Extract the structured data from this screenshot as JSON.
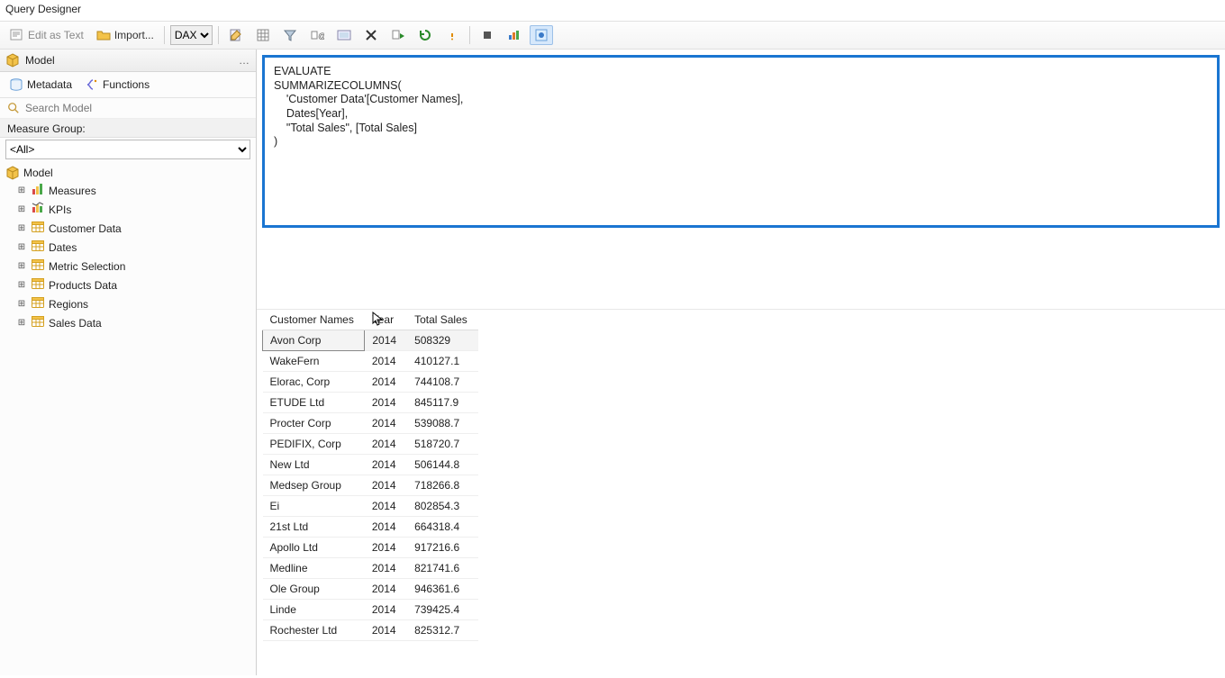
{
  "window": {
    "title": "Query Designer"
  },
  "toolbar": {
    "edit_as_text": "Edit as Text",
    "import": "Import...",
    "lang_value": "DAX"
  },
  "panel": {
    "title": "Model",
    "tab_metadata": "Metadata",
    "tab_functions": "Functions",
    "search_placeholder": "Search Model",
    "measure_group_label": "Measure Group:",
    "measure_group_value": "<All>"
  },
  "tree": {
    "root": "Model",
    "items": [
      {
        "label": "Measures",
        "icon": "measures"
      },
      {
        "label": "KPIs",
        "icon": "kpis"
      },
      {
        "label": "Customer Data",
        "icon": "table"
      },
      {
        "label": "Dates",
        "icon": "table"
      },
      {
        "label": "Metric Selection",
        "icon": "table"
      },
      {
        "label": "Products Data",
        "icon": "table"
      },
      {
        "label": "Regions",
        "icon": "table"
      },
      {
        "label": "Sales Data",
        "icon": "table"
      }
    ]
  },
  "query_text": "EVALUATE\nSUMMARIZECOLUMNS(\n    'Customer Data'[Customer Names],\n    Dates[Year],\n    \"Total Sales\", [Total Sales]\n)",
  "results": {
    "columns": [
      "Customer Names",
      "Year",
      "Total Sales"
    ],
    "rows": [
      [
        "Avon Corp",
        "2014",
        "508329"
      ],
      [
        "WakeFern",
        "2014",
        "410127.1"
      ],
      [
        "Elorac, Corp",
        "2014",
        "744108.7"
      ],
      [
        "ETUDE Ltd",
        "2014",
        "845117.9"
      ],
      [
        "Procter Corp",
        "2014",
        "539088.7"
      ],
      [
        "PEDIFIX, Corp",
        "2014",
        "518720.7"
      ],
      [
        "New Ltd",
        "2014",
        "506144.8"
      ],
      [
        "Medsep Group",
        "2014",
        "718266.8"
      ],
      [
        "Ei",
        "2014",
        "802854.3"
      ],
      [
        "21st Ltd",
        "2014",
        "664318.4"
      ],
      [
        "Apollo Ltd",
        "2014",
        "917216.6"
      ],
      [
        "Medline",
        "2014",
        "821741.6"
      ],
      [
        "Ole Group",
        "2014",
        "946361.6"
      ],
      [
        "Linde",
        "2014",
        "739425.4"
      ],
      [
        "Rochester Ltd",
        "2014",
        "825312.7"
      ]
    ],
    "selected_row": 0
  }
}
